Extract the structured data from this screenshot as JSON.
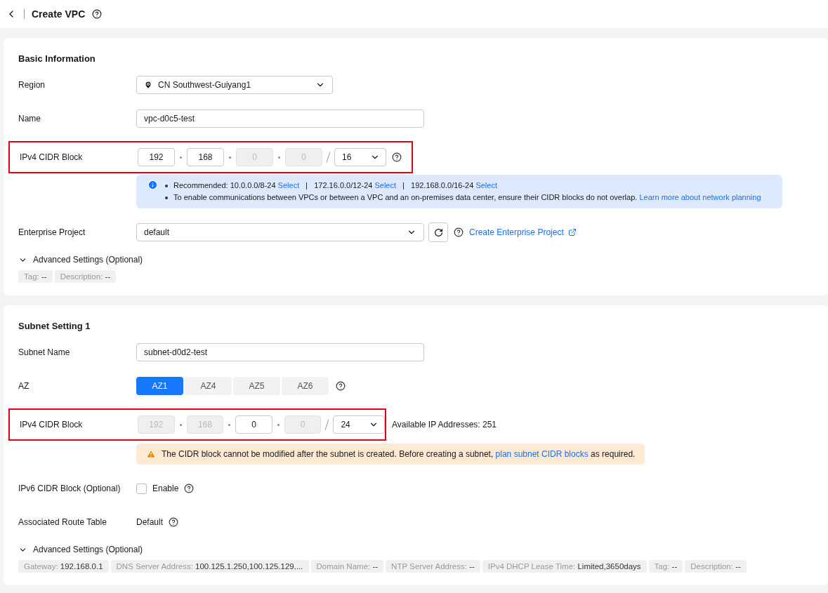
{
  "header": {
    "title": "Create VPC"
  },
  "basic": {
    "title": "Basic Information",
    "region": {
      "label": "Region",
      "value": "CN Southwest-Guiyang1"
    },
    "name": {
      "label": "Name",
      "value": "vpc-d0c5-test"
    },
    "cidr": {
      "label": "IPv4 CIDR Block",
      "highlighted": true,
      "octets": [
        {
          "value": "192",
          "disabled": false
        },
        {
          "value": "168",
          "disabled": false
        },
        {
          "value": "0",
          "disabled": true
        },
        {
          "value": "0",
          "disabled": true
        }
      ],
      "mask": "16"
    },
    "info": {
      "recommended": [
        {
          "text": "Recommended: 10.0.0.0/8-24",
          "link": "Select"
        },
        {
          "text": "172.16.0.0/12-24",
          "link": "Select"
        },
        {
          "text": "192.168.0.0/16-24",
          "link": "Select"
        }
      ],
      "note": "To enable communications between VPCs or between a VPC and an on-premises data center, ensure their CIDR blocks do not overlap.",
      "note_link": "Learn more about network planning"
    },
    "enterprise": {
      "label": "Enterprise Project",
      "value": "default",
      "link": "Create Enterprise Project"
    },
    "advanced": {
      "label": "Advanced Settings (Optional)",
      "expanded": true,
      "tags": [
        {
          "label": "Tag:",
          "value": "--"
        },
        {
          "label": "Description:",
          "value": "--"
        }
      ]
    }
  },
  "subnet": {
    "title": "Subnet Setting 1",
    "name": {
      "label": "Subnet Name",
      "value": "subnet-d0d2-test"
    },
    "az": {
      "label": "AZ",
      "options": [
        {
          "label": "AZ1",
          "selected": true
        },
        {
          "label": "AZ4",
          "selected": false
        },
        {
          "label": "AZ5",
          "selected": false
        },
        {
          "label": "AZ6",
          "selected": false
        }
      ]
    },
    "cidr": {
      "label": "IPv4 CIDR Block",
      "highlighted": true,
      "octets": [
        {
          "value": "192",
          "disabled": true
        },
        {
          "value": "168",
          "disabled": true
        },
        {
          "value": "0",
          "disabled": false
        },
        {
          "value": "0",
          "disabled": true
        }
      ],
      "mask": "24",
      "available": "Available IP Addresses: 251"
    },
    "warning": {
      "text": "The CIDR block cannot be modified after the subnet is created. Before creating a subnet,",
      "link": "plan subnet CIDR blocks",
      "tail": "as required."
    },
    "ipv6": {
      "label": "IPv6 CIDR Block (Optional)",
      "checkbox_label": "Enable",
      "checked": false
    },
    "route": {
      "label": "Associated Route Table",
      "value": "Default"
    },
    "advanced": {
      "label": "Advanced Settings (Optional)",
      "expanded": true,
      "tags": [
        {
          "label": "Gateway:",
          "value": "192.168.0.1"
        },
        {
          "label": "DNS Server Address:",
          "value": "100.125.1.250,100.125.129...."
        },
        {
          "label": "Domain Name:",
          "value": "--"
        },
        {
          "label": "NTP Server Address:",
          "value": "--"
        },
        {
          "label": "IPv4 DHCP Lease Time:",
          "value": "Limited,3650days"
        },
        {
          "label": "Tag:",
          "value": "--"
        },
        {
          "label": "Description:",
          "value": "--"
        }
      ]
    }
  }
}
